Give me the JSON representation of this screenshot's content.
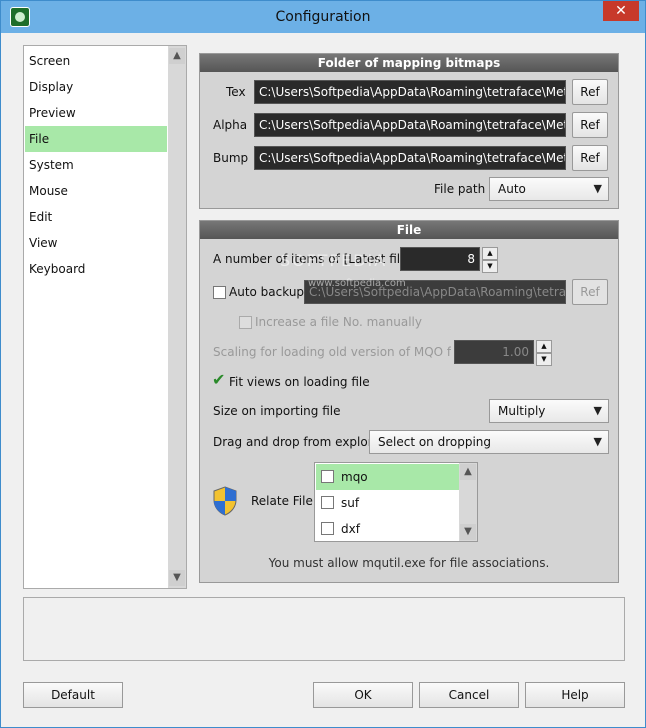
{
  "window": {
    "title": "Configuration",
    "close_glyph": "✕"
  },
  "sidebar": {
    "items": [
      {
        "label": "Screen"
      },
      {
        "label": "Display"
      },
      {
        "label": "Preview"
      },
      {
        "label": "File"
      },
      {
        "label": "System"
      },
      {
        "label": "Mouse"
      },
      {
        "label": "Edit"
      },
      {
        "label": "View"
      },
      {
        "label": "Keyboard"
      }
    ],
    "selected": "File"
  },
  "mapping": {
    "title": "Folder of mapping bitmaps",
    "rows": [
      {
        "label": "Tex",
        "value": "C:\\Users\\Softpedia\\AppData\\Roaming\\tetraface\\Metasequoia",
        "button": "Ref"
      },
      {
        "label": "Alpha",
        "value": "C:\\Users\\Softpedia\\AppData\\Roaming\\tetraface\\Metasequoia",
        "button": "Ref"
      },
      {
        "label": "Bump",
        "value": "C:\\Users\\Softpedia\\AppData\\Roaming\\tetraface\\Metasequoia",
        "button": "Ref"
      }
    ],
    "file_path_label": "File path",
    "file_path_value": "Auto"
  },
  "file": {
    "title": "File",
    "latest_files_label": "A number of items of [Latest files]",
    "latest_files_value": "8",
    "auto_backup_label": "Auto backup",
    "auto_backup_path": "C:\\Users\\Softpedia\\AppData\\Roaming\\tetraface\\Metasequoia",
    "auto_backup_button": "Ref",
    "increase_label": "Increase a file No. manually",
    "scaling_label": "Scaling for loading old version of MQO file",
    "scaling_value": "1.00",
    "fit_views_label": "Fit views on loading file",
    "size_import_label": "Size on importing file",
    "size_import_value": "Multiply",
    "drag_drop_label": "Drag and drop from explore",
    "drag_drop_value": "Select on dropping",
    "relate_label": "Relate File",
    "relate_items": [
      {
        "label": "mqo"
      },
      {
        "label": "suf"
      },
      {
        "label": "dxf"
      }
    ],
    "notice": "You must allow mqutil.exe for file associations."
  },
  "footer": {
    "default_label": "Default",
    "ok_label": "OK",
    "cancel_label": "Cancel",
    "help_label": "Help"
  },
  "watermark": {
    "brand": "SOFTPEDIA",
    "url": "www.softpedia.com"
  },
  "colors": {
    "selected": "#a8e8a8",
    "titlebar": "#6cb0e6"
  }
}
